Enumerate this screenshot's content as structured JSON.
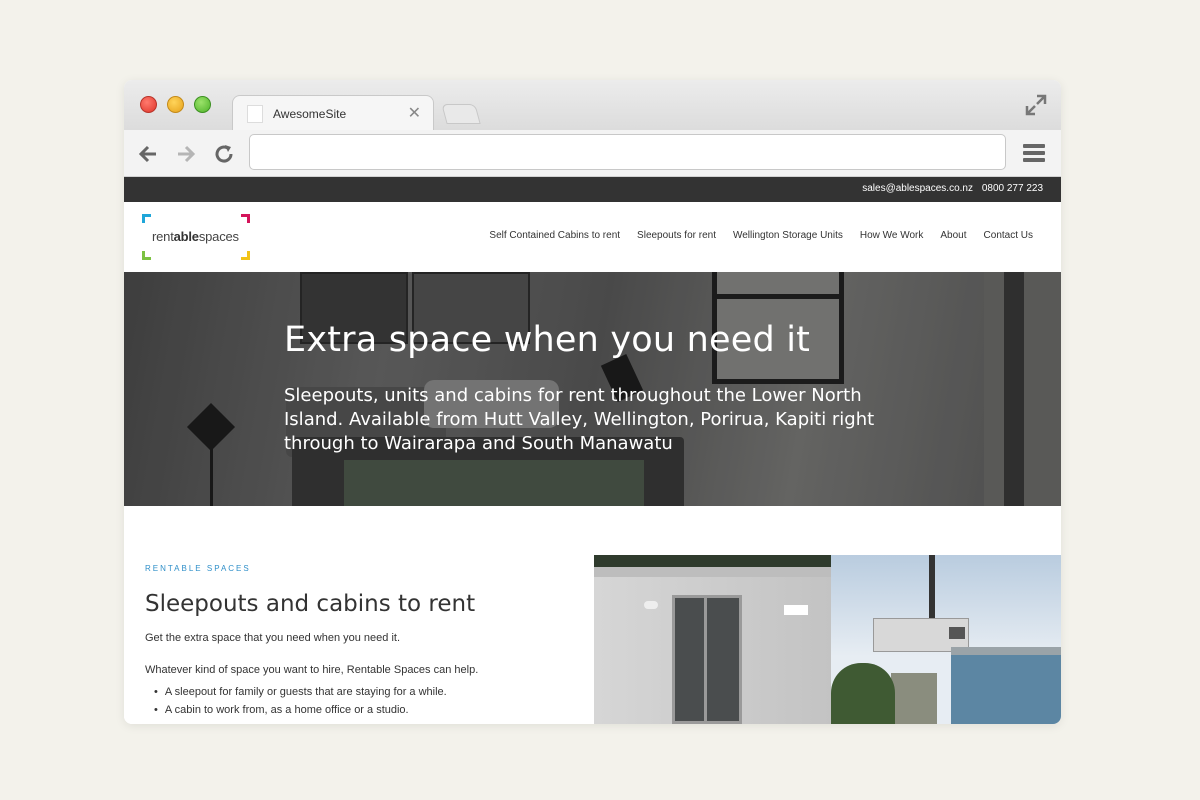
{
  "browser": {
    "tab_title": "AwesomeSite",
    "tab_close": "✕",
    "address_value": ""
  },
  "site": {
    "topbar": {
      "email": "sales@ablespaces.co.nz",
      "phone": "0800 277 223"
    },
    "logo": {
      "part1": "rent",
      "part2": "able",
      "part3": "spaces"
    },
    "nav": [
      "Self Contained Cabins to rent",
      "Sleepouts for rent",
      "Wellington Storage Units",
      "How We Work",
      "About",
      "Contact Us"
    ],
    "hero": {
      "title": "Extra space when you need it",
      "subtitle": "Sleepouts, units and cabins for rent throughout the Lower North Island.  Available from Hutt Valley, Wellington, Porirua, Kapiti right through to Wairarapa and South Manawatu"
    },
    "section": {
      "eyebrow": "RENTABLE SPACES",
      "title": "Sleepouts and cabins to rent",
      "intro1": "Get the extra space that you need when you need it.",
      "intro2": "Whatever kind of space you want to hire, Rentable Spaces can help.",
      "bullets": [
        "A sleepout for family or guests that are staying for a while.",
        "A cabin to work from, as a home office or a studio."
      ]
    }
  },
  "colors": {
    "topbar_bg": "#333333",
    "eyebrow": "#2f8fc9",
    "logo_tl": "#1fa6d9",
    "logo_tr": "#d4145a",
    "logo_bl": "#7cc242",
    "logo_br": "#f2c318"
  }
}
